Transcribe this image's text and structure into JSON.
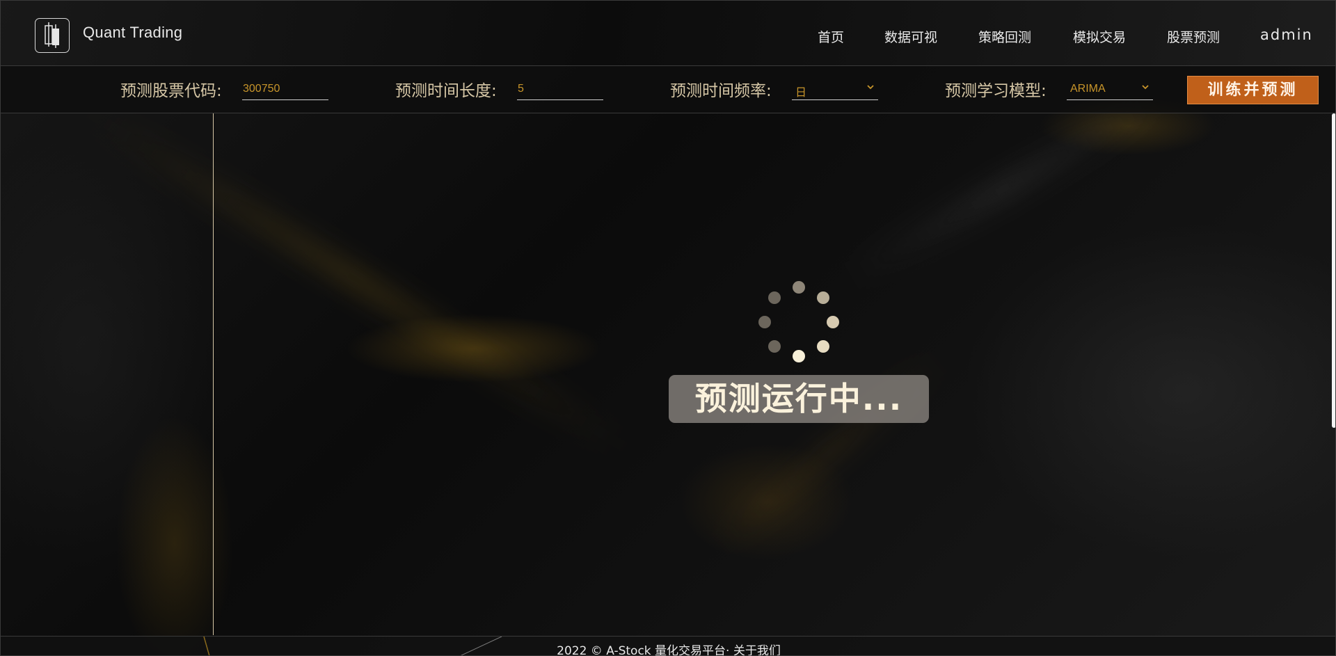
{
  "header": {
    "brand": "Quant Trading",
    "nav": [
      {
        "label": "首页"
      },
      {
        "label": "数据可视"
      },
      {
        "label": "策略回测"
      },
      {
        "label": "模拟交易"
      },
      {
        "label": "股票预测"
      }
    ],
    "user": "admin",
    "logo_icon": "candlestick-icon"
  },
  "toolbar": {
    "stock_code_label": "预测股票代码:",
    "stock_code_value": "300750",
    "horizon_label": "预测时间长度:",
    "horizon_value": "5",
    "frequency_label": "预测时间频率:",
    "frequency_value": "日",
    "model_label": "预测学习模型:",
    "model_value": "ARIMA",
    "train_button": "训练并预测"
  },
  "loading": {
    "message": "预测运行中..."
  },
  "footer": {
    "text": "2022 © A-Stock 量化交易平台· 关于我们"
  },
  "colors": {
    "accent": "#c0601a",
    "field_text": "#c8952a",
    "label_text": "#d6c7a6",
    "loading_text": "#fbf2dc"
  }
}
